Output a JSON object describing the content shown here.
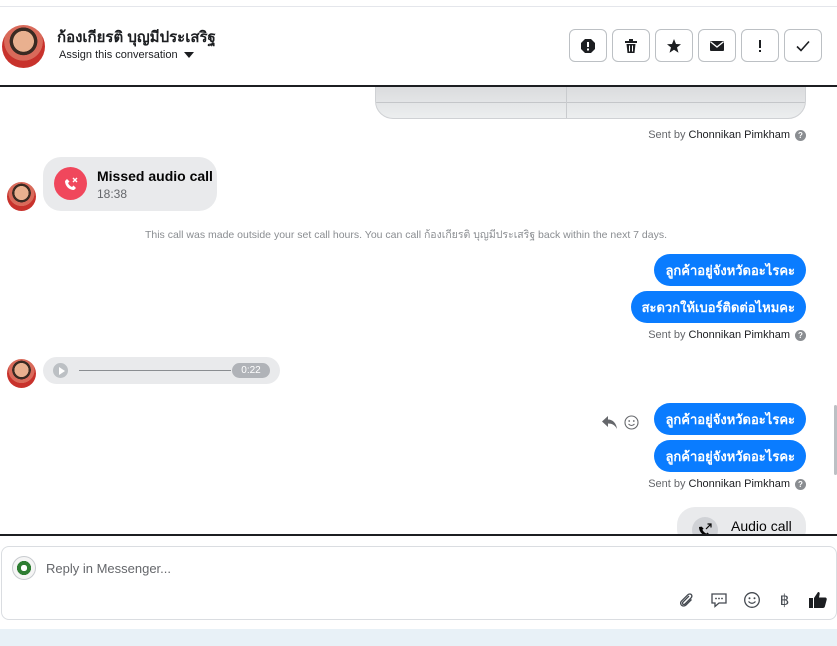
{
  "header": {
    "contact_name": "ก้องเกียรติ บุญมีประเสริฐ",
    "assign_label": "Assign this conversation",
    "tools": [
      "spam-icon",
      "trash-icon",
      "star-icon",
      "mark-unread-icon",
      "important-icon",
      "done-check-icon"
    ]
  },
  "thread": {
    "sent_by_prefix": "Sent by",
    "agent_name": "Chonnikan Pimkham",
    "missed_call": {
      "title": "Missed audio call",
      "time": "18:38"
    },
    "call_notice": "This call was made outside your set call hours. You can call ก้องเกียรติ บุญมีประเสริฐ back within the next 7 days.",
    "outgoing_group_1": [
      "ลูกค้าอยู่จังหวัดอะไรคะ",
      "สะดวกให้เบอร์ติดต่อไหมคะ"
    ],
    "voice_message": {
      "duration": "0:22"
    },
    "outgoing_group_2": [
      "ลูกค้าอยู่จังหวัดอะไรคะ",
      "ลูกค้าอยู่จังหวัดอะไรคะ"
    ],
    "audio_call": {
      "title": "Audio call"
    }
  },
  "composer": {
    "placeholder": "Reply in Messenger...",
    "icons": [
      "attachment-icon",
      "saved-reply-icon",
      "emoji-icon",
      "baht-payment-icon",
      "thumbs-up-icon"
    ],
    "baht_symbol": "฿"
  },
  "colors": {
    "outgoing_bubble": "#0a7cff",
    "incoming_bubble": "#e9eaec",
    "missed_call_red": "#f0475c"
  }
}
